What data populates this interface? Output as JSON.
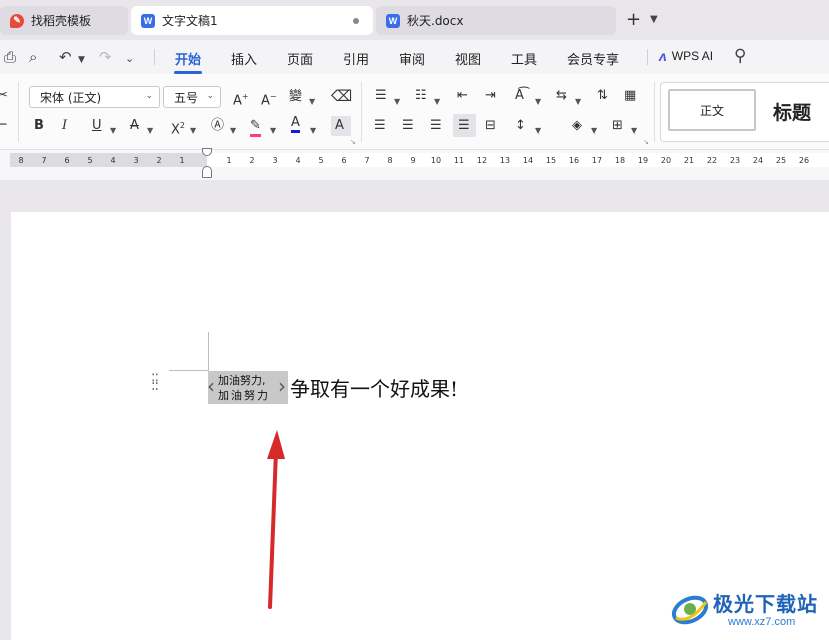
{
  "tabs": [
    {
      "label": "找稻壳模板",
      "icon": "docer-icon"
    },
    {
      "label": "文字文稿1",
      "icon": "wps-writer-icon",
      "modified": true
    },
    {
      "label": "秋天.docx",
      "icon": "wps-writer-icon"
    }
  ],
  "tabbar": {
    "new_tab": "+",
    "more": "⌄"
  },
  "menu": {
    "items": [
      "开始",
      "插入",
      "页面",
      "引用",
      "审阅",
      "视图",
      "工具",
      "会员专享"
    ],
    "active": "开始",
    "ai_label": "WPS AI"
  },
  "toolbar": {
    "font_name": "宋体 (正文)",
    "font_size": "五号",
    "styles": {
      "normal": "正文",
      "heading": "标题"
    }
  },
  "ruler": {
    "left_numbers": [
      "8",
      "7",
      "6",
      "5",
      "4",
      "3",
      "2",
      "1"
    ],
    "right_numbers": [
      "1",
      "2",
      "3",
      "4",
      "5",
      "6",
      "7",
      "8",
      "9",
      "10",
      "11",
      "12",
      "13",
      "14",
      "15",
      "16",
      "17",
      "18",
      "19",
      "20",
      "21",
      "22",
      "23",
      "24",
      "25",
      "26"
    ]
  },
  "document": {
    "combined_line1": "加油努力,",
    "combined_line2": "加油努力",
    "bracket_left": "‹",
    "bracket_right": "›",
    "body_text": "争取有一个好成果!"
  },
  "watermark": {
    "name": "极光下载站",
    "url": "www.xz7.com"
  },
  "colors": {
    "accent": "#2a63d9",
    "arrow": "#d62a2a",
    "font_color": "#1a1adb"
  }
}
